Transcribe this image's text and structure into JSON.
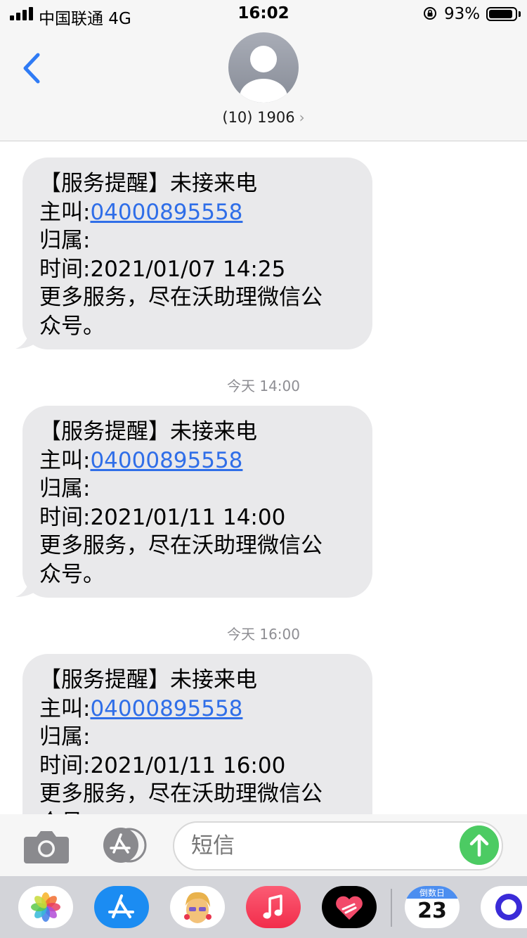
{
  "status_bar": {
    "carrier": "中国联通  4G",
    "time": "16:02",
    "battery_percent": "93%",
    "battery_level": 0.93
  },
  "header": {
    "contact_name": "(10) 1906",
    "chevron": "›"
  },
  "messages": [
    {
      "title": "【服务提醒】未接来电",
      "caller_label": "主叫:",
      "caller_number": "04000895558",
      "belong_label": "归属:",
      "time_line": "时间:2021/01/07 14:25",
      "footer_1": "更多服务，尽在沃助理微信公",
      "footer_2": "众号。"
    },
    {
      "timestamp": "今天 14:00",
      "title": "【服务提醒】未接来电",
      "caller_label": "主叫:",
      "caller_number": "04000895558",
      "belong_label": "归属:",
      "time_line": "时间:2021/01/11 14:00",
      "footer_1": "更多服务，尽在沃助理微信公",
      "footer_2": "众号。"
    },
    {
      "timestamp": "今天 16:00",
      "title": "【服务提醒】未接来电",
      "caller_label": "主叫:",
      "caller_number": "04000895558",
      "belong_label": "归属:",
      "time_line": "时间:2021/01/11 16:00",
      "footer_1": "更多服务，尽在沃助理微信公",
      "footer_2": "众号。"
    }
  ],
  "input_bar": {
    "placeholder": "短信"
  },
  "app_drawer": {
    "apps": [
      "photos-icon",
      "app-store-icon",
      "memoji-icon",
      "music-icon",
      "heart-app-icon",
      "countdown-calendar-icon",
      "circle-app-icon"
    ],
    "countdown_label": "倒数日",
    "countdown_day": "23"
  },
  "colors": {
    "bubble_bg": "#e9e9eb",
    "link": "#2f6ee8",
    "accent_blue": "#2f7bf5",
    "send_green": "#4ccb63"
  }
}
